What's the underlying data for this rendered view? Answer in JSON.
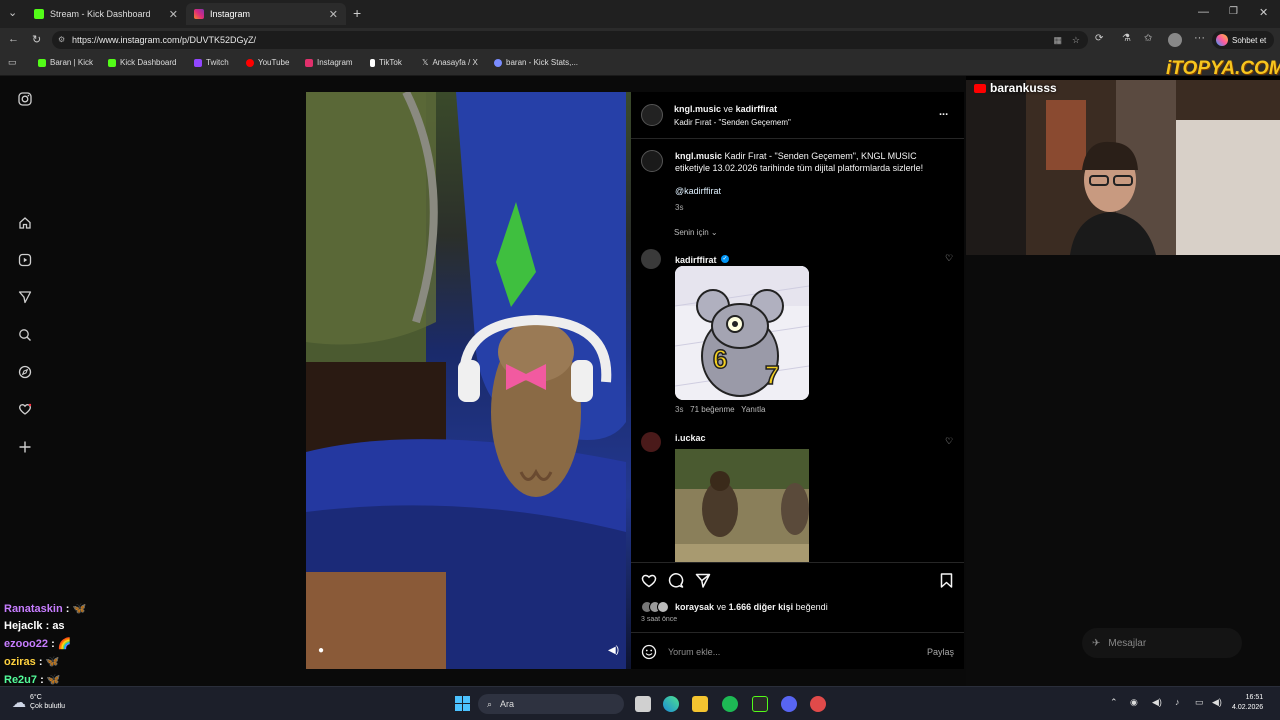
{
  "tabs": [
    {
      "label": "Stream - Kick Dashboard",
      "close": "✕"
    },
    {
      "label": "Instagram",
      "close": "✕"
    }
  ],
  "new_tab": "+",
  "window_controls": [
    "—",
    "❐",
    "✕"
  ],
  "address": {
    "url": "https://www.instagram.com/p/DUVTK52DGyZ/"
  },
  "browser_right": {
    "chat_label": "Sohbet et"
  },
  "bookmarks": [
    {
      "label": "Baran | Kick",
      "color": "#53fc18"
    },
    {
      "label": "Kick Dashboard",
      "color": "#53fc18"
    },
    {
      "label": "Twitch",
      "color": "#9146ff"
    },
    {
      "label": "YouTube",
      "color": "#ff0000"
    },
    {
      "label": "Instagram",
      "color": "#e1306c"
    },
    {
      "label": "TikTok",
      "color": "#ffffff"
    },
    {
      "label": "Anasayfa / X",
      "color": "#ffffff"
    },
    {
      "label": "baran - Kick Stats,...",
      "color": "#7a8cff"
    }
  ],
  "post": {
    "header_user1": "kngl.music",
    "header_and": "ve",
    "header_user2": "kadirffirat",
    "header_subtitle": "Kadir Fırat - \"Senden Geçemem\"",
    "more": "...",
    "caption_user": "kngl.music",
    "caption_text": "Kadir Fırat - \"Senden Geçemem\", KNGL MUSIC etiketiyle 13.02.2026 tarihinde tüm dijital platformlarda sizlerle!",
    "mention": "@kadirffirat",
    "caption_time": "3s",
    "sort_label": "Senin için",
    "comments": [
      {
        "user": "kadirffirat",
        "verified": true,
        "time": "3s",
        "likes": "71 beğenme",
        "reply": "Yanıtla"
      },
      {
        "user": "i.uckac"
      }
    ],
    "liked_by_user": "koraysak",
    "liked_by_mid": "ve",
    "liked_by_rest": "1.666 diğer kişi",
    "liked_by_end": "beğendi",
    "posted_time": "3 saat önce",
    "comment_placeholder": "Yorum ekle...",
    "share_label": "Paylaş"
  },
  "stream": {
    "channel": "barankusss",
    "watermark": "iTOPYA.COM",
    "messages_label": "Mesajlar"
  },
  "chat": [
    {
      "user": "Ranataskin",
      "text": "",
      "emoji": "🦋",
      "color": "#c77dff"
    },
    {
      "user": "Hejaclk",
      "text": "as",
      "emoji": "",
      "color": "#ffffff"
    },
    {
      "user": "ezooo22",
      "text": "",
      "emoji": "🌈",
      "color": "#c77dff"
    },
    {
      "user": "oziras",
      "text": "",
      "emoji": "🦋",
      "color": "#ffd23f"
    },
    {
      "user": "Re2u7",
      "text": "",
      "emoji": "🦋",
      "color": "#53fc9a"
    }
  ],
  "taskbar": {
    "weather_temp": "6°C",
    "weather_desc": "Çok bulutlu",
    "search": "Ara",
    "time": "16:51",
    "date": "4.02.2026"
  }
}
